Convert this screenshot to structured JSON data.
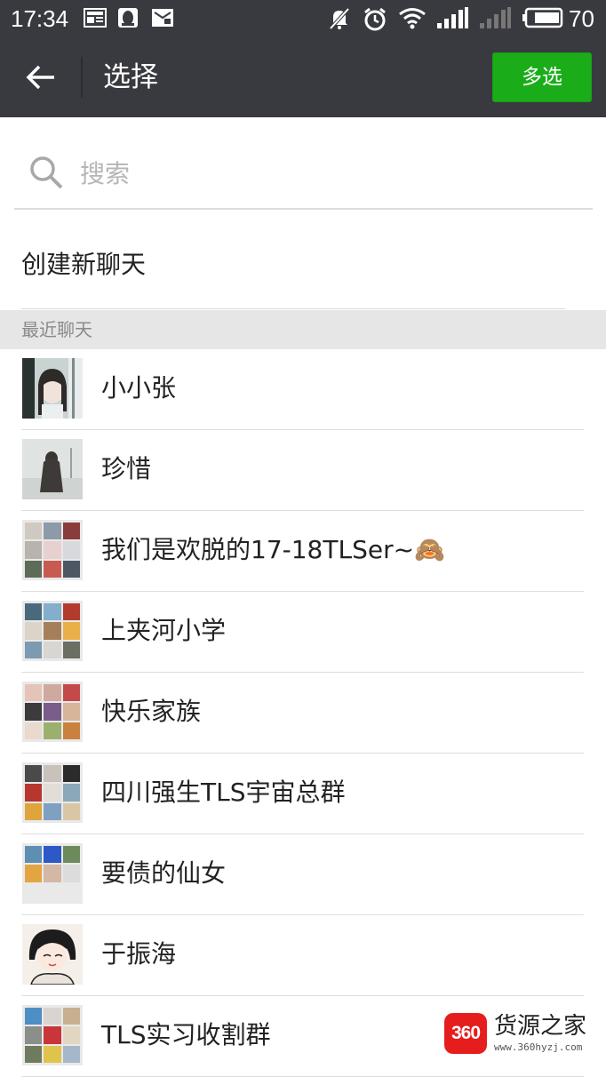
{
  "status_bar": {
    "time": "17:34",
    "battery_level": "70",
    "icons": [
      "news-icon",
      "penguin-icon",
      "mail-icon",
      "mute-icon",
      "alarm-icon",
      "wifi-icon",
      "signal-icon",
      "signal-weak-icon",
      "battery-icon"
    ]
  },
  "header": {
    "title": "选择",
    "back_icon": "arrow-left-icon",
    "multi_select_label": "多选"
  },
  "colors": {
    "header_bg": "#393a3f",
    "accent_green": "#1aad19",
    "section_bg": "#e6e6e6"
  },
  "search": {
    "placeholder": "搜索",
    "value": ""
  },
  "new_chat": {
    "label": "创建新聊天"
  },
  "recent_section": {
    "title": "最近聊天"
  },
  "chats": [
    {
      "name": "小小张",
      "avatar": "photo-girl-window"
    },
    {
      "name": "珍惜",
      "avatar": "photo-girl-back"
    },
    {
      "name": "我们是欢脱的17-18TLSer~🙈",
      "avatar": "group-grid"
    },
    {
      "name": "上夹河小学",
      "avatar": "group-grid"
    },
    {
      "name": "快乐家族",
      "avatar": "group-grid"
    },
    {
      "name": "四川强生TLS宇宙总群",
      "avatar": "group-grid"
    },
    {
      "name": "要债的仙女",
      "avatar": "group-grid"
    },
    {
      "name": "于振海",
      "avatar": "photo-anime-boy"
    },
    {
      "name": "TLS实习收割群",
      "avatar": "group-grid"
    }
  ],
  "watermark": {
    "badge": "360",
    "text": "货源之家",
    "url": "www.360hyzj.com"
  }
}
